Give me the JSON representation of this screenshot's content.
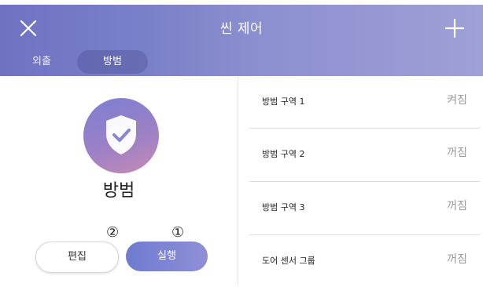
{
  "header": {
    "title": "씬 제어",
    "tabs": [
      {
        "label": "외출",
        "selected": false
      },
      {
        "label": "방범",
        "selected": true
      }
    ]
  },
  "scene": {
    "name": "방범",
    "icon": "shield-check-icon",
    "edit_label": "편집",
    "run_label": "실행",
    "marker_edit": "②",
    "marker_run": "①"
  },
  "zones": [
    {
      "label": "방범 구역 1",
      "state": "켜짐"
    },
    {
      "label": "방범 구역 2",
      "state": "꺼짐"
    },
    {
      "label": "방범 구역 3",
      "state": "꺼짐"
    },
    {
      "label": "도어 센서 그룹",
      "state": "꺼짐"
    }
  ],
  "colors": {
    "header_start": "#6f72c2",
    "header_end": "#9ea0d6",
    "icon_start": "#7d7fd4",
    "icon_end": "#c58bb5",
    "run_button": "#7b84d3"
  }
}
